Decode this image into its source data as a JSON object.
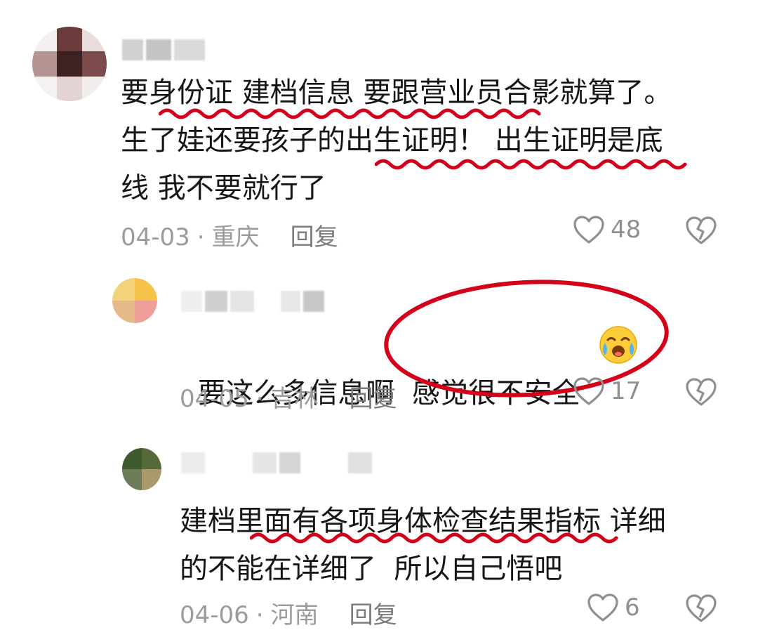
{
  "comments": [
    {
      "text": "要身份证 建档信息 要跟营业员合影就算了。\n生了娃还要孩子的出生证明！ 出生证明是底\n线 我不要就行了",
      "date": "04-03",
      "location": "重庆",
      "reply_label": "回复",
      "likes": "48"
    },
    {
      "text": "要这么多信息啊  感觉很不安全",
      "emoji": "crying-laughing-face",
      "date": "04-05",
      "location": "吉林",
      "reply_label": "回复",
      "likes": "17"
    },
    {
      "text": "建档里面有各项身体检查结果指标 详细\n的不能在详细了  所以自己悟吧",
      "date": "04-06",
      "location": "河南",
      "reply_label": "回复",
      "likes": "6"
    }
  ],
  "separator": "·",
  "colors": {
    "annotation_red": "#d4001a",
    "meta_gray": "#9b9b9b",
    "text": "#161616"
  },
  "icons": [
    "heart-outline-icon",
    "broken-heart-icon",
    "crying-laughing-emoji"
  ]
}
